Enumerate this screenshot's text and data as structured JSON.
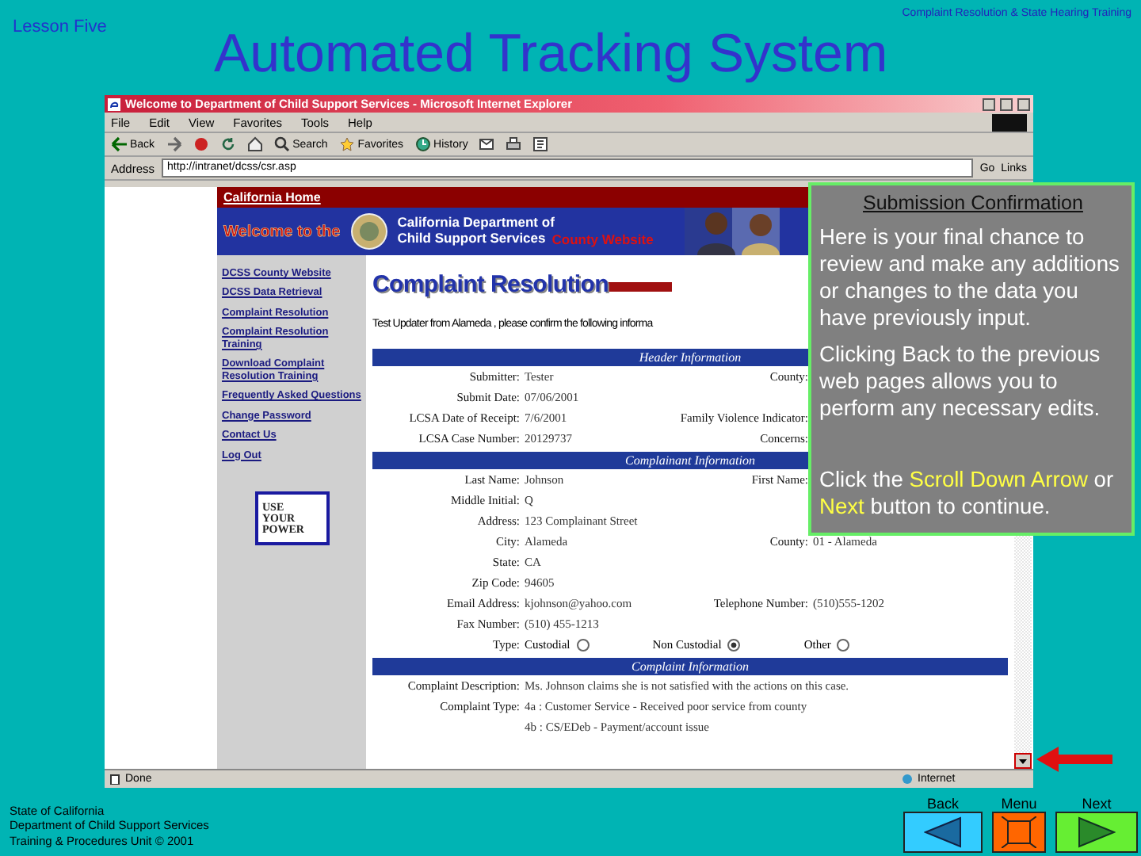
{
  "slide": {
    "lesson": "Lesson Five",
    "title": "Automated Tracking System",
    "course": "Complaint Resolution & State Hearing Training",
    "credits": [
      "State of California",
      "Department of Child Support Services",
      "Training & Procedures Unit © 2001"
    ],
    "nav": [
      {
        "kind": "back",
        "label": "Back"
      },
      {
        "kind": "menu",
        "label": "Menu"
      },
      {
        "kind": "next",
        "label": "Next"
      }
    ]
  },
  "browser": {
    "title": "Welcome to Department of Child Support Services - Microsoft Internet Explorer",
    "menu": [
      "File",
      "Edit",
      "View",
      "Favorites",
      "Tools",
      "Help"
    ],
    "toolbar": [
      {
        "kind": "back",
        "label": "Back"
      },
      {
        "kind": "forward"
      },
      {
        "kind": "stop"
      },
      {
        "kind": "refresh"
      },
      {
        "kind": "home"
      },
      {
        "kind": "search",
        "label": "Search"
      },
      {
        "kind": "favorites",
        "label": "Favorites"
      },
      {
        "kind": "history",
        "label": "History"
      },
      {
        "kind": "mail"
      },
      {
        "kind": "print"
      },
      {
        "kind": "edit"
      }
    ],
    "address_label": "Address",
    "address": "http://intranet/dcss/csr.asp",
    "go": "Go",
    "links": "Links",
    "status": "Done",
    "zone": "Internet"
  },
  "site": {
    "home_link": "California Home",
    "welcome": "Welcome to the",
    "department": [
      "California Department of",
      "Child Support Services"
    ],
    "county": "County Website",
    "sidebar": [
      {
        "label": "DCSS County Website"
      },
      {
        "label": "DCSS Data Retrieval"
      },
      {
        "label": "Complaint Resolution"
      },
      {
        "label": "Complaint Resolution Training"
      },
      {
        "label": "Download Complaint Resolution Training"
      },
      {
        "label": "Frequently Asked Questions"
      },
      {
        "label": "Change Password"
      },
      {
        "label": "Contact Us"
      },
      {
        "label": "Log Out"
      }
    ],
    "badge": [
      "USE",
      "YOUR",
      "POWER"
    ],
    "logo": "Complaint Resolution",
    "intro": "Test Updater from Alameda , please confirm the following informa",
    "sections": [
      {
        "title": "Header Information",
        "rows": [
          {
            "kind": "field",
            "label": "Submitter:",
            "value": "Tester",
            "label_2": "County:"
          },
          {
            "kind": "field",
            "label": "Submit Date:",
            "value": "07/06/2001"
          },
          {
            "kind": "field",
            "label": "LCSA Date of Receipt:",
            "value": "7/6/2001",
            "label_2": "Family Violence Indicator:"
          },
          {
            "kind": "field",
            "label": "LCSA Case Number:",
            "value": "20129737",
            "label_2": "Concerns:"
          }
        ]
      },
      {
        "title": "Complainant Information",
        "rows": [
          {
            "kind": "field",
            "label": "Last Name:",
            "value": "Johnson",
            "label_2": "First Name:"
          },
          {
            "kind": "field",
            "label": "Middle Initial:",
            "value": "Q"
          },
          {
            "kind": "field",
            "label": "Address:",
            "value": "123 Complainant Street"
          },
          {
            "kind": "field",
            "label": "City:",
            "value": "Alameda",
            "label_2": "County:",
            "value_2": "01 - Alameda"
          },
          {
            "kind": "field",
            "label": "State:",
            "value": "CA"
          },
          {
            "kind": "field",
            "label": "Zip Code:",
            "value": "94605"
          },
          {
            "kind": "field",
            "label": "Email Address:",
            "value": "kjohnson@yahoo.com",
            "label_2": "Telephone Number:",
            "value_2": "(510)555-1202"
          },
          {
            "kind": "field",
            "label": "Fax Number:",
            "value": "(510) 455-1213"
          },
          {
            "kind": "options",
            "label": "Type:",
            "options": [
              {
                "label": "Custodial",
                "selected": false
              },
              {
                "label": "Non Custodial",
                "selected": true
              },
              {
                "label": "Other",
                "selected": false
              }
            ]
          }
        ]
      },
      {
        "title": "Complaint Information",
        "rows": [
          {
            "kind": "field",
            "label": "Complaint Description:",
            "value": "Ms. Johnson claims she is not satisfied with the actions on this case."
          },
          {
            "kind": "field",
            "label": "Complaint Type:",
            "value": "4a : Customer Service - Received poor service from county"
          },
          {
            "kind": "continuation",
            "value": "4b : CS/EDeb - Payment/account issue"
          }
        ]
      }
    ]
  },
  "callout": {
    "title": "Submission Confirmation",
    "paragraphs": [
      [
        {
          "text": "Here is your final chance to review and make any additions or changes to the data you have previously input.",
          "highlight": false
        }
      ],
      [
        {
          "text": "Clicking Back to the previous web pages allows you to perform any necessary edits.",
          "highlight": false
        }
      ],
      [
        {
          "text": "Click the ",
          "highlight": false
        },
        {
          "text": "Scroll Down Arrow",
          "highlight": true
        },
        {
          "text": " or ",
          "highlight": false
        },
        {
          "text": "Next",
          "highlight": true
        },
        {
          "text": " button to continue.",
          "highlight": false
        }
      ]
    ]
  }
}
